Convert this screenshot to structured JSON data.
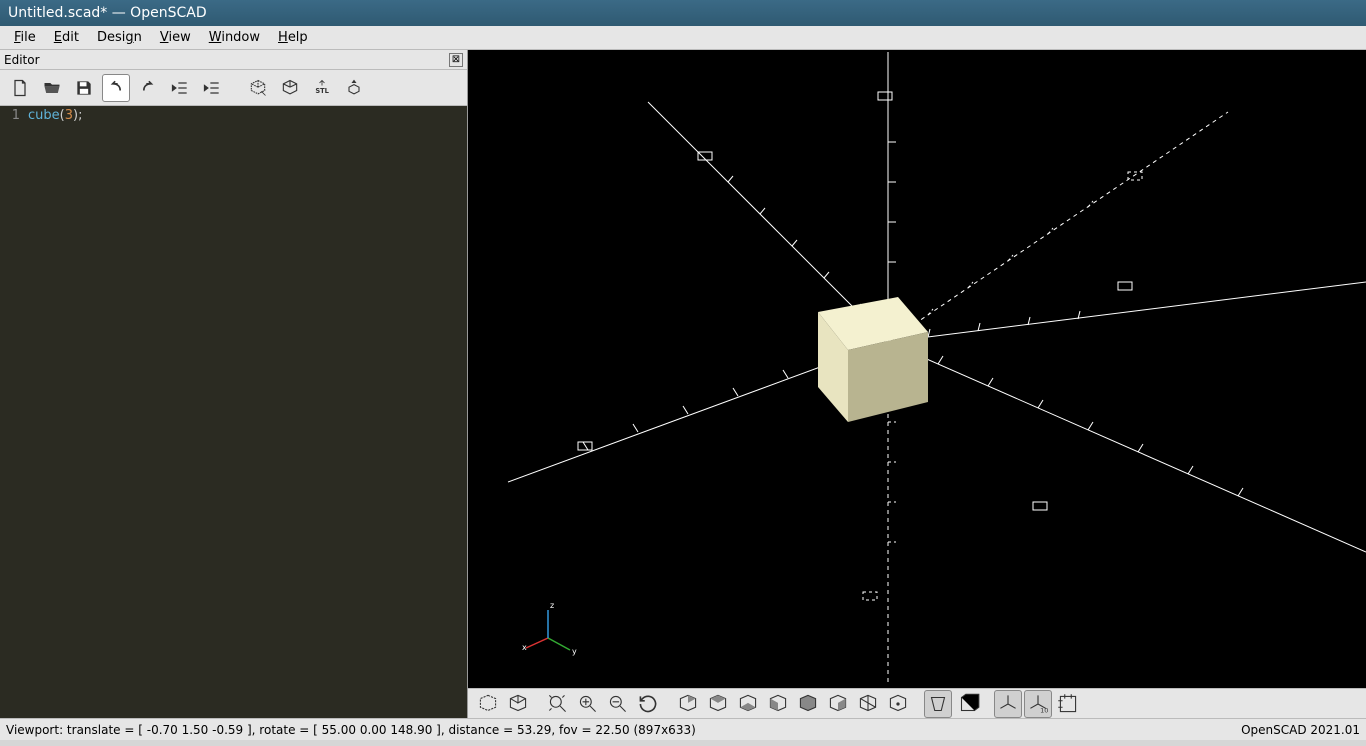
{
  "window": {
    "title": "Untitled.scad* — OpenSCAD"
  },
  "menu": {
    "file": "File",
    "edit": "Edit",
    "design": "Design",
    "view": "View",
    "window": "Window",
    "help": "Help"
  },
  "editor": {
    "panel_title": "Editor",
    "line_number": "1",
    "code_keyword": "cube",
    "code_open": "(",
    "code_arg": "3",
    "code_close": ")",
    "code_semi": ";",
    "toolbar": {
      "new": "New",
      "open": "Open",
      "save": "Save",
      "undo": "Undo",
      "redo": "Redo",
      "unindent": "Unindent",
      "indent": "Indent",
      "preview": "Preview",
      "render": "Render",
      "export_stl": "STL",
      "send_to_3d": "3D"
    }
  },
  "viewport_toolbar": {
    "preview": "Preview",
    "render": "Render",
    "zoom_all": "View All",
    "zoom_in": "Zoom In",
    "zoom_out": "Zoom Out",
    "reset": "Reset View",
    "right": "Right",
    "top": "Top",
    "bottom": "Bottom",
    "left": "Left",
    "front": "Front",
    "back": "Back",
    "diagonal": "Diagonal",
    "center": "Center",
    "perspective": "Perspective",
    "ortho": "Orthogonal",
    "axes": "Show Axes",
    "scale_marker": "Scale Markers",
    "edges": "Show Edges"
  },
  "axes_labels": {
    "x": "x",
    "y": "y",
    "z": "z"
  },
  "status": {
    "viewport": "Viewport: translate = [ -0.70 1.50 -0.59 ], rotate = [ 55.00 0.00 148.90 ], distance = 53.29, fov = 22.50 (897x633)",
    "version": "OpenSCAD 2021.01"
  }
}
